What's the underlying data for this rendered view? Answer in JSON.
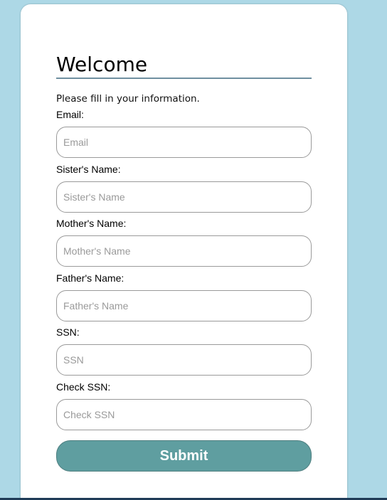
{
  "form": {
    "title": "Welcome",
    "subtitle": "Please fill in your information.",
    "fields": [
      {
        "label": "Email:",
        "placeholder": "Email"
      },
      {
        "label": "Sister's Name:",
        "placeholder": "Sister's Name"
      },
      {
        "label": "Mother's Name:",
        "placeholder": "Mother's Name"
      },
      {
        "label": "Father's Name:",
        "placeholder": "Father's Name"
      },
      {
        "label": "SSN:",
        "placeholder": "SSN"
      },
      {
        "label": "Check SSN:",
        "placeholder": "Check SSN"
      }
    ],
    "submit_label": "Submit"
  },
  "colors": {
    "page_background": "#add8e6",
    "card_background": "#ffffff",
    "button_background": "#5f9ea0",
    "title_underline": "#6f8fa0"
  }
}
